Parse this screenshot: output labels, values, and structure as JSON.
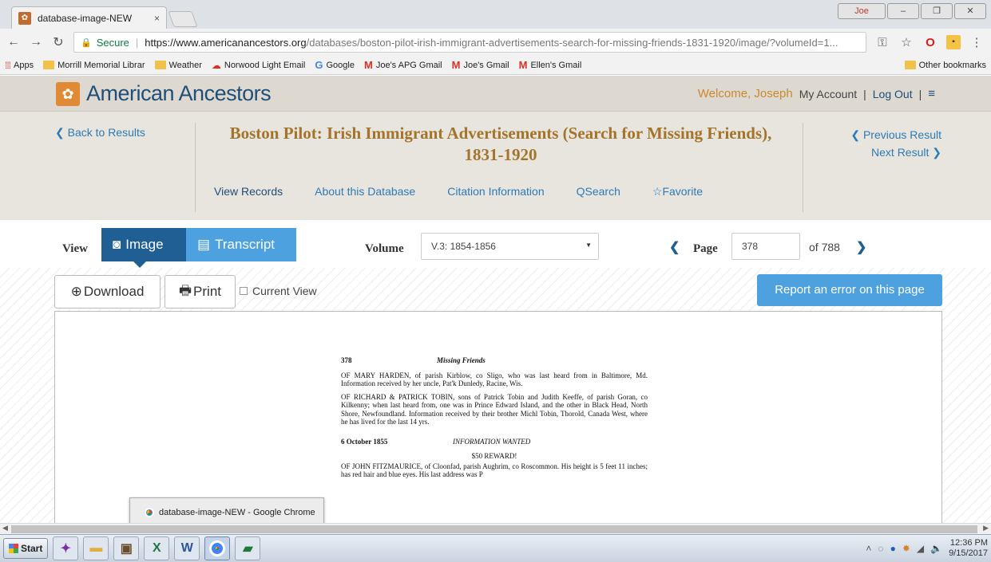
{
  "browser": {
    "tab_title": "database-image-NEW",
    "tab_close": "×",
    "user_badge": "Joe",
    "url_secure_label": "Secure",
    "url_host": "https://www.americanancestors.org",
    "url_path": "/databases/boston-pilot-irish-immigrant-advertisements-search-for-missing-friends-1831-1920/image/?volumeId=1...",
    "bookmarks": [
      {
        "label": "Apps",
        "icon": "apps-icon"
      },
      {
        "label": "Morrill Memorial Librar",
        "icon": "folder-icon"
      },
      {
        "label": "Weather",
        "icon": "folder-icon"
      },
      {
        "label": "Norwood Light Email",
        "icon": "cloud-icon"
      },
      {
        "label": "Google",
        "icon": "google-icon"
      },
      {
        "label": "Joe's APG Gmail",
        "icon": "gmail-icon"
      },
      {
        "label": "Joe's Gmail",
        "icon": "gmail-icon"
      },
      {
        "label": "Ellen's Gmail",
        "icon": "gmail-icon"
      }
    ],
    "other_bookmarks": "Other bookmarks"
  },
  "site": {
    "logo_text": "American Ancestors",
    "welcome": "Welcome, Joseph",
    "my_account": "My Account",
    "divider": "|",
    "log_out": "Log Out",
    "menu_icon": "≡"
  },
  "database": {
    "back_to_results": "❮ Back to Results",
    "title": "Boston Pilot: Irish Immigrant Advertisements (Search for Missing Friends), 1831-1920",
    "previous_result": "❮ Previous Result",
    "next_result": "Next Result ❯",
    "links": {
      "view_records": "View Records",
      "about": "About this Database",
      "citation": "Citation Information",
      "search": "Search",
      "favorite": "Favorite"
    }
  },
  "viewer": {
    "view_label": "View",
    "image_tab": "Image",
    "transcript_tab": "Transcript",
    "volume_label": "Volume",
    "volume_value": "V.3: 1854-1856",
    "page_label": "Page",
    "page_value": "378",
    "page_of": "of 788",
    "download": "Download",
    "print": "Print",
    "current_view": "Current View",
    "report_error": "Report an error on this page"
  },
  "document": {
    "page_number": "378",
    "running_title": "Missing Friends",
    "entries": [
      "OF MARY HARDEN, of parish Kirblow, co Sligo, who was last heard from in Baltimore, Md. Information received by her uncle, Pat'k Dunledy, Racine, Wis.",
      "OF RICHARD & PATRICK TOBIN, sons of Patrick Tobin and Judith Keeffe, of parish Goran, co Kilkenny; when last heard from, one was in Prince Edward Island, and the other in Black Head, North Shore, Newfoundland. Information received by their brother Michl Tobin, Thorold, Canada West, where he has lived for the last 14 yrs."
    ],
    "section_date": "6 October 1855",
    "section_title": "INFORMATION WANTED",
    "reward": "$50 REWARD!",
    "entry_3": "OF JOHN FITZMAURICE, of Cloonfad, parish Aughrim, co Roscommon. His height is 5 feet 11 inches; has red hair and blue eyes. His last address was P"
  },
  "hover_popup": "database-image-NEW - Google Chrome",
  "taskbar": {
    "start": "Start",
    "time": "12:36 PM",
    "date": "9/15/2017"
  },
  "colors": {
    "accent_blue": "#4da1de",
    "dark_blue": "#1f5f93",
    "gold_title": "#a3742a",
    "logo_orange": "#e08a35"
  }
}
